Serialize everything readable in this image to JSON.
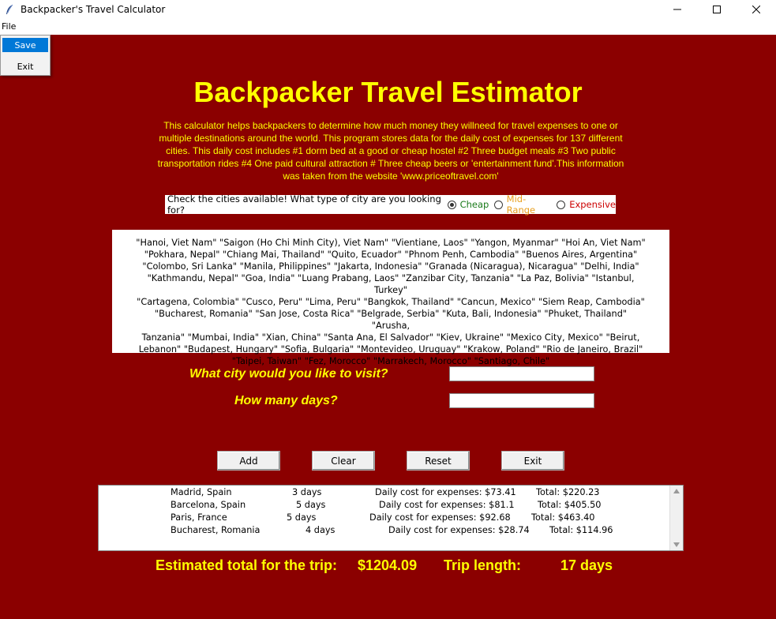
{
  "window": {
    "title": "Backpacker's Travel Calculator"
  },
  "menu": {
    "file_label": "File",
    "items": [
      {
        "label": "Save"
      },
      {
        "label": "Exit"
      }
    ]
  },
  "heading": "Backpacker Travel Estimator",
  "description_lines": [
    "This calculator helps backpackers to determine how much money they willneed for travel expenses to one or",
    "multiple destinations around the world. This program stores data for the daily cost of expenses for 137 different",
    "cities. This daily cost includes #1 dorm bed at a good or cheap hostel  #2 Three budget meals   #3 Two public",
    "transportation rides #4 One paid cultural attraction   # Three cheap beers or 'entertainment fund'.This information",
    "was taken from the website 'www.priceoftravel.com'"
  ],
  "city_type": {
    "question": "Check the cities available! What type of city are you looking for?",
    "options": [
      {
        "label": "Cheap",
        "color": "#1a7a1a",
        "selected": true
      },
      {
        "label": "Mid-Range",
        "color": "#e8a020",
        "selected": false
      },
      {
        "label": "Expensive",
        "color": "#cc0000",
        "selected": false
      }
    ]
  },
  "cities_lines": [
    "\"Hanoi, Viet Nam\"  \"Saigon (Ho Chi Minh City), Viet Nam\"  \"Vientiane, Laos\"  \"Yangon, Myanmar\"  \"Hoi An, Viet Nam\"",
    "\"Pokhara, Nepal\"  \"Chiang Mai, Thailand\"  \"Quito, Ecuador\"  \"Phnom Penh, Cambodia\"  \"Buenos Aires, Argentina\"",
    "\"Colombo, Sri Lanka\"  \"Manila, Philippines\"  \"Jakarta, Indonesia\"  \"Granada (Nicaragua), Nicaragua\"  \"Delhi, India\"",
    "\"Kathmandu, Nepal\"  \"Goa, India\"  \"Luang Prabang, Laos\"  \"Zanzibar City, Tanzania\"  \"La Paz, Bolivia\"  \"Istanbul, Turkey\"",
    "\"Cartagena, Colombia\"  \"Cusco, Peru\"  \"Lima, Peru\"  \"Bangkok, Thailand\"  \"Cancun, Mexico\"  \"Siem Reap, Cambodia\"",
    "\"Bucharest, Romania\"  \"San Jose, Costa Rica\"  \"Belgrade, Serbia\"  \"Kuta, Bali, Indonesia\"  \"Phuket, Thailand\"  \"Arusha,",
    "Tanzania\"  \"Mumbai, India\"  \"Xian, China\"  \"Santa Ana, El Salvador\"  \"Kiev, Ukraine\"  \"Mexico City, Mexico\"  \"Beirut,",
    "Lebanon\"  \"Budapest, Hungary\"  \"Sofia, Bulgaria\"  \"Montevideo, Uruguay\"  \"Krakow, Poland\"  \"Rio de Janeiro, Brazil\"",
    "\"Taipei, Taiwan\"  \"Fez, Morocco\"  \"Marrakech, Morocco\"  \"Santiago, Chile\""
  ],
  "form": {
    "city_question": "What city would you like to visit?",
    "city_value": "",
    "days_question": "How many days?",
    "days_value": ""
  },
  "buttons": {
    "add": "Add",
    "clear": "Clear",
    "reset": "Reset",
    "exit": "Exit"
  },
  "trips": [
    {
      "city": "Madrid, Spain",
      "days": "3 days",
      "daily": "Daily cost for expenses: $73.41",
      "total": "Total: $220.23"
    },
    {
      "city": "Barcelona, Spain",
      "days": "5 days",
      "daily": "Daily cost for expenses: $81.1",
      "total": "Total: $405.50"
    },
    {
      "city": "Paris, France",
      "days": "5 days",
      "daily": "Daily cost for expenses: $92.68",
      "total": "Total: $463.40"
    },
    {
      "city": "Bucharest, Romania",
      "days": "4 days",
      "daily": "Daily cost for expenses: $28.74",
      "total": "Total: $114.96"
    }
  ],
  "summary": {
    "estimated_label": "Estimated total for the trip:",
    "estimated_value": "$1204.09",
    "length_label": "Trip length:",
    "length_value": "17 days"
  },
  "colors": {
    "background": "#8b0000",
    "accent_text": "#ffff00",
    "menu_highlight": "#0078d7"
  }
}
